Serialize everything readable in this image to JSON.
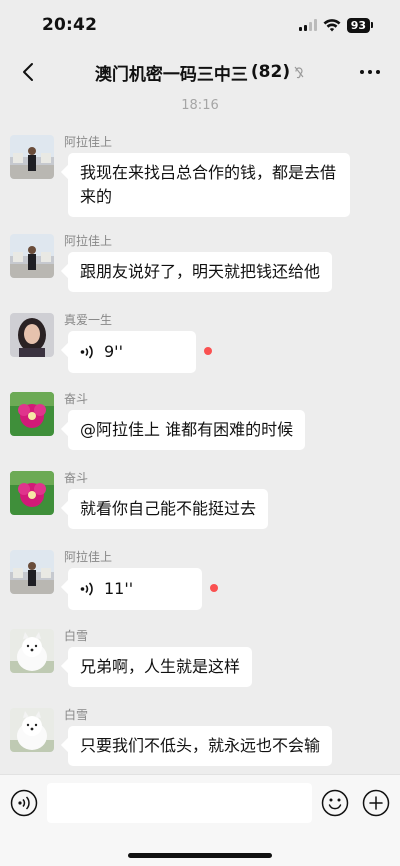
{
  "status_bar": {
    "time": "20:42",
    "battery": "93"
  },
  "header": {
    "title": "澳门机密一码三中三",
    "member_count": "(82)"
  },
  "timestamp": "18:16",
  "messages": [
    {
      "sender": "阿拉佳上",
      "avatar": "man-photo",
      "text": "我现在来找吕总合作的钱，都是去借来的"
    },
    {
      "sender": "阿拉佳上",
      "avatar": "man-photo",
      "text": "跟朋友说好了，明天就把钱还给他"
    },
    {
      "sender": "真爱一生",
      "avatar": "woman-photo",
      "voice_duration": "9''",
      "unread": true
    },
    {
      "sender": "奋斗",
      "avatar": "flower-photo",
      "text": "@阿拉佳上 谁都有困难的时候"
    },
    {
      "sender": "奋斗",
      "avatar": "flower-photo",
      "text": "就看你自己能不能挺过去"
    },
    {
      "sender": "阿拉佳上",
      "avatar": "man-photo",
      "voice_duration": "11''",
      "unread": true
    },
    {
      "sender": "白雪",
      "avatar": "dog-photo",
      "text": "兄弟啊，人生就是这样"
    },
    {
      "sender": "白雪",
      "avatar": "dog-photo",
      "text": "只要我们不低头，就永远也不会输"
    }
  ],
  "input": {
    "value": ""
  },
  "colors": {
    "background": "#ededed",
    "bubble": "#ffffff",
    "unread": "#fa5151"
  }
}
